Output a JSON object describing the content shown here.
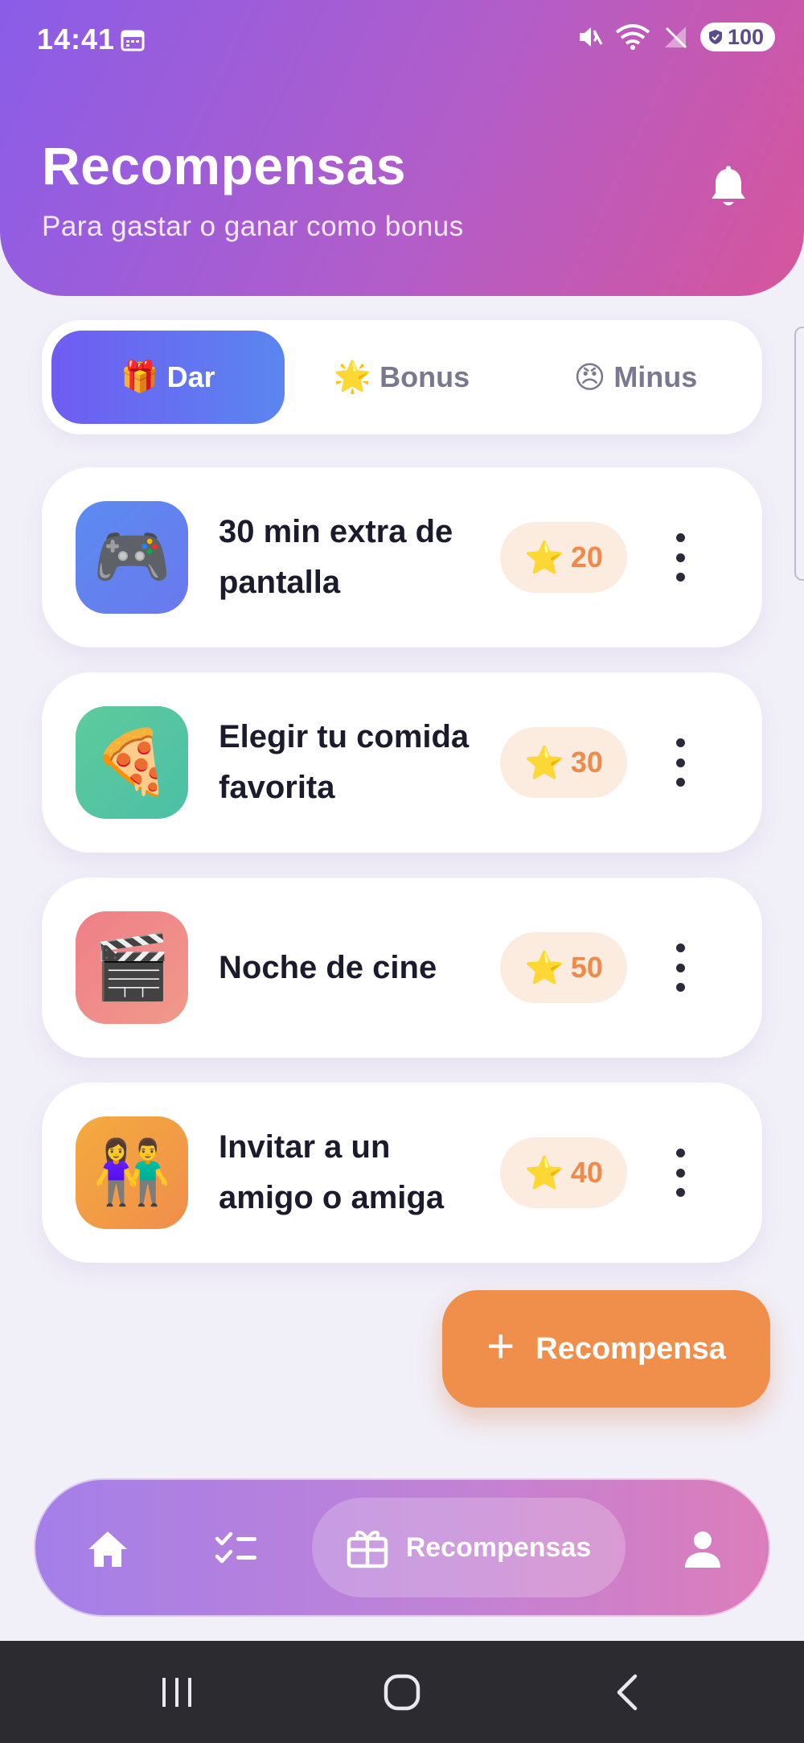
{
  "status_bar": {
    "time": "14:41",
    "battery": "100"
  },
  "header": {
    "title": "Recompensas",
    "subtitle": "Para gastar o ganar como bonus"
  },
  "tabs": [
    {
      "emoji": "🎁",
      "label": "Dar",
      "active": true
    },
    {
      "emoji": "🌟",
      "label": "Bonus",
      "active": false
    },
    {
      "emoji": "😠",
      "label": "Minus",
      "active": false
    }
  ],
  "rewards": [
    {
      "emoji": "🎮",
      "name": "30 min extra de pantalla",
      "points": "20",
      "icon_color": "#5b8cf0"
    },
    {
      "emoji": "🍕",
      "name": "Elegir tu comida favorita",
      "points": "30",
      "icon_color": "#5ecb9c"
    },
    {
      "emoji": "🎬",
      "name": "Noche de cine",
      "points": "50",
      "icon_color": "#ef8585"
    },
    {
      "emoji": "👫",
      "name": "Invitar a un amigo o amiga",
      "points": "40",
      "icon_color": "#f4a242"
    }
  ],
  "star_glyph": "⭐",
  "fab": {
    "plus": "+",
    "label": "Recompensa"
  },
  "bottom_nav": {
    "items": [
      "home-icon",
      "tasks-icon",
      "gift-icon",
      "profile-icon"
    ],
    "active_label": "Recompensas"
  },
  "colors": {
    "accent_purple": "#6f5cf2",
    "accent_orange": "#ef8f4b",
    "header_start": "#8a5de8",
    "header_end": "#d6559c"
  }
}
